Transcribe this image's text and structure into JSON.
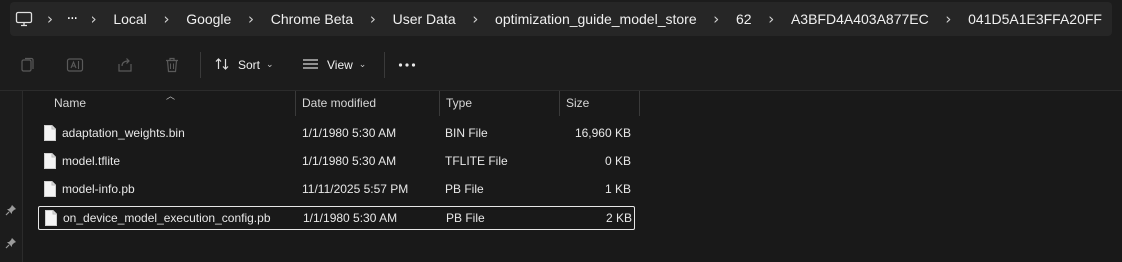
{
  "address_bar": {
    "overflow": "···",
    "crumbs": [
      "Local",
      "Google",
      "Chrome Beta",
      "User Data",
      "optimization_guide_model_store",
      "62",
      "A3BFD4A403A877EC",
      "041D5A1E3FFA20FF"
    ]
  },
  "toolbar": {
    "sort_label": "Sort",
    "view_label": "View"
  },
  "columns": {
    "name": "Name",
    "date": "Date modified",
    "type": "Type",
    "size": "Size"
  },
  "files": [
    {
      "name": "adaptation_weights.bin",
      "date": "1/1/1980 5:30 AM",
      "type": "BIN File",
      "size": "16,960 KB",
      "selected": false
    },
    {
      "name": "model.tflite",
      "date": "1/1/1980 5:30 AM",
      "type": "TFLITE File",
      "size": "0 KB",
      "selected": false
    },
    {
      "name": "model-info.pb",
      "date": "11/11/2025 5:57 PM",
      "type": "PB File",
      "size": "1 KB",
      "selected": false
    },
    {
      "name": "on_device_model_execution_config.pb",
      "date": "1/1/1980 5:30 AM",
      "type": "PB File",
      "size": "2 KB",
      "selected": true
    }
  ],
  "colors": {
    "background": "#191919",
    "address_field": "#262626",
    "selection_border": "#e6e6e6",
    "text": "#e8e8e8"
  }
}
